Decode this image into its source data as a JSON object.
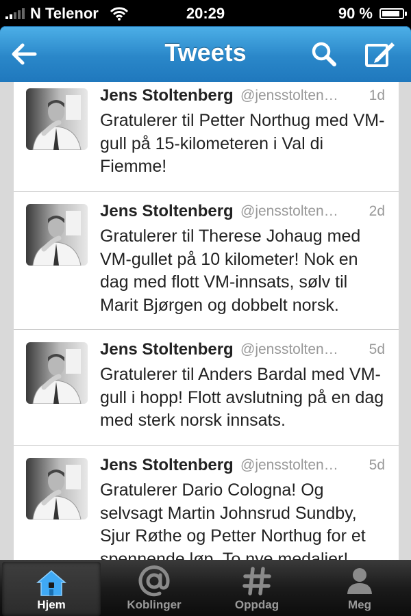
{
  "status_bar": {
    "carrier": "N Telenor",
    "time": "20:29",
    "battery": "90 %",
    "battery_level": 0.9
  },
  "header": {
    "title": "Tweets",
    "back_icon": "back-arrow-icon",
    "search_icon": "search-icon",
    "compose_icon": "compose-icon"
  },
  "tweets": [
    {
      "name": "Jens Stoltenberg",
      "handle": "@jensstolten…",
      "time": "1d",
      "text": "Gratulerer til Petter Northug med VM-gull på 15-kilometeren i Val di Fiemme!"
    },
    {
      "name": "Jens Stoltenberg",
      "handle": "@jensstolten…",
      "time": "2d",
      "text": "Gratulerer til Therese Johaug med VM-gullet på 10 kilometer! Nok en dag med flott VM-innsats, sølv til Marit Bjørgen og dobbelt norsk."
    },
    {
      "name": "Jens Stoltenberg",
      "handle": "@jensstolten…",
      "time": "5d",
      "text": "Gratulerer til Anders Bardal med VM-gull i hopp! Flott avslutning på en dag med sterk norsk innsats."
    },
    {
      "name": "Jens Stoltenberg",
      "handle": "@jensstolten…",
      "time": "5d",
      "text": "Gratulerer Dario Cologna! Og selvsagt Martin Johnsrud Sundby, Sjur Røthe og Petter Northug for et spennende løp. To nye medalier!"
    }
  ],
  "tabs": [
    {
      "label": "Hjem",
      "icon": "home-icon",
      "active": true
    },
    {
      "label": "Koblinger",
      "icon": "at-icon",
      "active": false
    },
    {
      "label": "Oppdag",
      "icon": "hashtag-icon",
      "active": false
    },
    {
      "label": "Meg",
      "icon": "person-icon",
      "active": false
    }
  ],
  "colors": {
    "nav_blue": "#2a87c9",
    "home_icon_blue": "#3fa9f5"
  }
}
